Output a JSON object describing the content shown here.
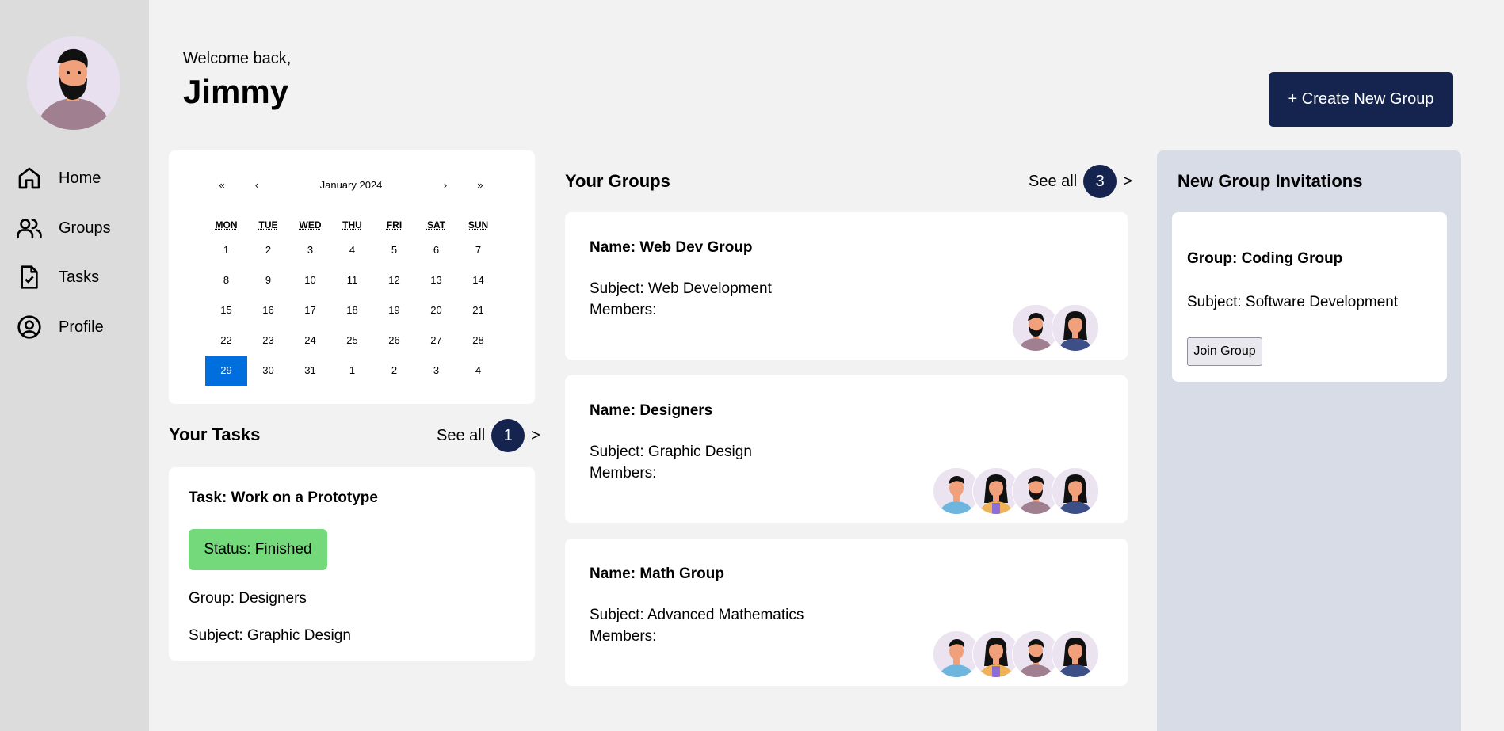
{
  "user": {
    "welcome": "Welcome back,",
    "name": "Jimmy"
  },
  "nav": [
    {
      "label": "Home",
      "icon": "home-icon"
    },
    {
      "label": "Groups",
      "icon": "users-icon"
    },
    {
      "label": "Tasks",
      "icon": "task-file-icon"
    },
    {
      "label": "Profile",
      "icon": "user-circle-icon"
    }
  ],
  "header": {
    "create_label": "+ Create New Group"
  },
  "calendar": {
    "title": "January 2024",
    "nav": {
      "first": "«",
      "prev": "‹",
      "next": "›",
      "last": "»"
    },
    "weekdays": [
      "MON",
      "TUE",
      "WED",
      "THU",
      "FRI",
      "SAT",
      "SUN"
    ],
    "days": [
      "1",
      "2",
      "3",
      "4",
      "5",
      "6",
      "7",
      "8",
      "9",
      "10",
      "11",
      "12",
      "13",
      "14",
      "15",
      "16",
      "17",
      "18",
      "19",
      "20",
      "21",
      "22",
      "23",
      "24",
      "25",
      "26",
      "27",
      "28",
      "29",
      "30",
      "31",
      "1",
      "2",
      "3",
      "4"
    ],
    "selected": "29"
  },
  "tasks": {
    "title": "Your Tasks",
    "see_all": "See all",
    "count": "1",
    "arrow": ">",
    "items": [
      {
        "title": "Task: Work on a Prototype",
        "status": "Status: Finished",
        "group": "Group: Designers",
        "subject": "Subject: Graphic Design"
      }
    ]
  },
  "groups": {
    "title": "Your Groups",
    "see_all": "See all",
    "count": "3",
    "arrow": ">",
    "items": [
      {
        "name": "Name: Web Dev Group",
        "subject": "Subject: Web Development",
        "members_label": "Members:",
        "members": [
          "bearded-man-avatar-icon",
          "woman-dark-hair-avatar-icon"
        ]
      },
      {
        "name": "Name: Designers",
        "subject": "Subject: Graphic Design",
        "members_label": "Members:",
        "members": [
          "man-blue-shirt-avatar-icon",
          "woman-yellow-jacket-avatar-icon",
          "bearded-man-avatar-icon",
          "woman-dark-hair-avatar-icon"
        ]
      },
      {
        "name": "Name: Math Group",
        "subject": "Subject: Advanced Mathematics",
        "members_label": "Members:",
        "members": [
          "man-blue-shirt-avatar-icon",
          "woman-yellow-jacket-avatar-icon",
          "bearded-man-avatar-icon",
          "woman-dark-hair-avatar-icon"
        ]
      }
    ]
  },
  "invitations": {
    "title": "New Group Invitations",
    "items": [
      {
        "group": "Group: Coding Group",
        "subject": "Subject: Software Development",
        "join_label": "Join Group"
      }
    ]
  },
  "colors": {
    "primary": "#14244f",
    "selected_day": "#006edc",
    "status_finished": "#74d97a",
    "sidebar": "#dcdcdc",
    "invitations_panel": "#d8dce6"
  }
}
